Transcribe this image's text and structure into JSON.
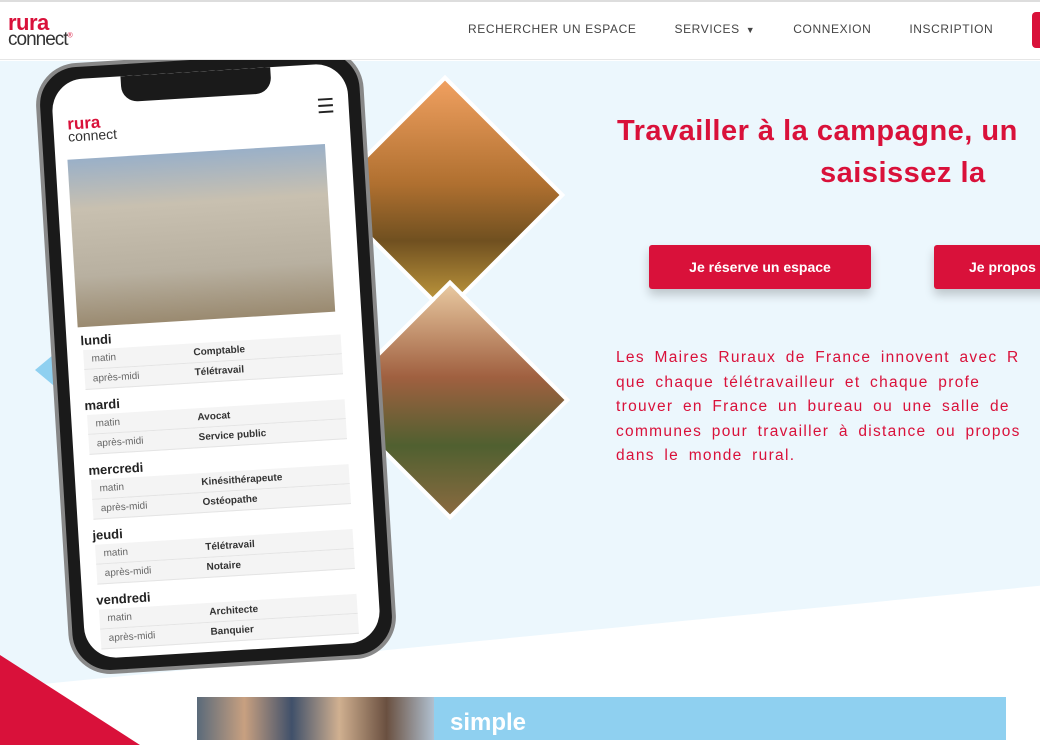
{
  "header": {
    "logo_top": "rura",
    "logo_bottom": "connect",
    "nav": [
      {
        "label": "RECHERCHER UN ESPACE"
      },
      {
        "label": "SERVICES",
        "icon": "caret-down-icon"
      },
      {
        "label": "CONNEXION"
      },
      {
        "label": "INSCRIPTION"
      }
    ]
  },
  "hero": {
    "title_line1": "Travailler à la campagne, un",
    "title_line2": "saisissez la",
    "buttons": [
      {
        "label": "Je réserve un espace"
      },
      {
        "label": "Je propos"
      }
    ],
    "paragraph": [
      "Les Maires Ruraux de France innovent avec R",
      "que chaque télétravailleur et chaque profe",
      "trouver en France un bureau ou une salle de",
      "communes pour travailler à distance ou propos",
      "dans le monde rural."
    ]
  },
  "phone": {
    "logo_top": "rura",
    "logo_bottom": "connect",
    "menu_icon": "hamburger-icon",
    "schedule": [
      {
        "day": "lundi",
        "slots": [
          {
            "time": "matin",
            "value": "Comptable"
          },
          {
            "time": "après-midi",
            "value": "Télétravail"
          }
        ]
      },
      {
        "day": "mardi",
        "slots": [
          {
            "time": "matin",
            "value": "Avocat"
          },
          {
            "time": "après-midi",
            "value": "Service public"
          }
        ]
      },
      {
        "day": "mercredi",
        "slots": [
          {
            "time": "matin",
            "value": "Kinésithérapeute"
          },
          {
            "time": "après-midi",
            "value": "Ostéopathe"
          }
        ]
      },
      {
        "day": "jeudi",
        "slots": [
          {
            "time": "matin",
            "value": "Télétravail"
          },
          {
            "time": "après-midi",
            "value": "Notaire"
          }
        ]
      },
      {
        "day": "vendredi",
        "slots": [
          {
            "time": "matin",
            "value": "Architecte"
          },
          {
            "time": "après-midi",
            "value": "Banquier"
          }
        ]
      }
    ]
  },
  "bottom": {
    "label": "simple"
  },
  "colors": {
    "brand_red": "#d9113a",
    "light_blue": "#8fd0f0",
    "hero_bg": "#ecf7fd"
  }
}
